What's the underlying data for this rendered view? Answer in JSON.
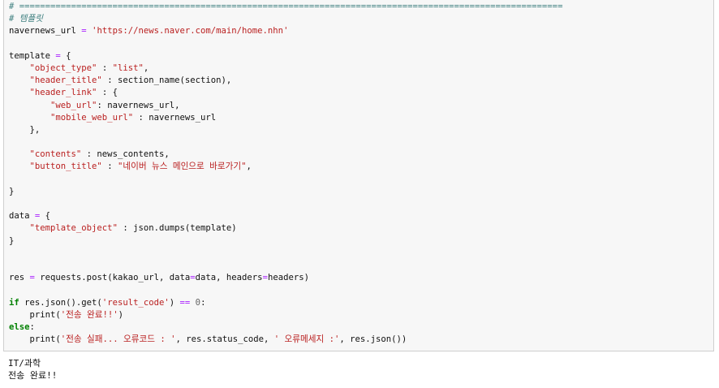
{
  "colors": {
    "cell_background": "#f7f7f7",
    "cell_border": "#cfcfcf",
    "comment": "#408080",
    "string": "#ba2121",
    "keyword": "#008000",
    "operator": "#aa22ff",
    "number": "#666666",
    "text": "#111111"
  },
  "code": [
    [
      {
        "t": "com",
        "v": "# ========================================================================================================="
      }
    ],
    [
      {
        "t": "com",
        "v": "# 템플릿"
      }
    ],
    [
      {
        "t": "txt",
        "v": "navernews_url "
      },
      {
        "t": "op",
        "v": "="
      },
      {
        "t": "txt",
        "v": " "
      },
      {
        "t": "str",
        "v": "'https://news.naver.com/main/home.nhn'"
      }
    ],
    [],
    [
      {
        "t": "txt",
        "v": "template "
      },
      {
        "t": "op",
        "v": "="
      },
      {
        "t": "txt",
        "v": " {"
      }
    ],
    [
      {
        "t": "txt",
        "v": "    "
      },
      {
        "t": "str",
        "v": "\"object_type\""
      },
      {
        "t": "txt",
        "v": " : "
      },
      {
        "t": "str",
        "v": "\"list\""
      },
      {
        "t": "txt",
        "v": ","
      }
    ],
    [
      {
        "t": "txt",
        "v": "    "
      },
      {
        "t": "str",
        "v": "\"header_title\""
      },
      {
        "t": "txt",
        "v": " : section_name(section),"
      }
    ],
    [
      {
        "t": "txt",
        "v": "    "
      },
      {
        "t": "str",
        "v": "\"header_link\""
      },
      {
        "t": "txt",
        "v": " : {"
      }
    ],
    [
      {
        "t": "txt",
        "v": "        "
      },
      {
        "t": "str",
        "v": "\"web_url\""
      },
      {
        "t": "txt",
        "v": ": navernews_url,"
      }
    ],
    [
      {
        "t": "txt",
        "v": "        "
      },
      {
        "t": "str",
        "v": "\"mobile_web_url\""
      },
      {
        "t": "txt",
        "v": " : navernews_url"
      }
    ],
    [
      {
        "t": "txt",
        "v": "    },"
      }
    ],
    [],
    [
      {
        "t": "txt",
        "v": "    "
      },
      {
        "t": "str",
        "v": "\"contents\""
      },
      {
        "t": "txt",
        "v": " : news_contents,"
      }
    ],
    [
      {
        "t": "txt",
        "v": "    "
      },
      {
        "t": "str",
        "v": "\"button_title\""
      },
      {
        "t": "txt",
        "v": " : "
      },
      {
        "t": "str",
        "v": "\"네이버 뉴스 메인으로 바로가기\""
      },
      {
        "t": "txt",
        "v": ","
      }
    ],
    [],
    [
      {
        "t": "txt",
        "v": "}"
      }
    ],
    [],
    [
      {
        "t": "txt",
        "v": "data "
      },
      {
        "t": "op",
        "v": "="
      },
      {
        "t": "txt",
        "v": " {"
      }
    ],
    [
      {
        "t": "txt",
        "v": "    "
      },
      {
        "t": "str",
        "v": "\"template_object\""
      },
      {
        "t": "txt",
        "v": " : json.dumps(template)"
      }
    ],
    [
      {
        "t": "txt",
        "v": "}"
      }
    ],
    [],
    [],
    [
      {
        "t": "txt",
        "v": "res "
      },
      {
        "t": "op",
        "v": "="
      },
      {
        "t": "txt",
        "v": " requests.post(kakao_url, data"
      },
      {
        "t": "op",
        "v": "="
      },
      {
        "t": "txt",
        "v": "data, headers"
      },
      {
        "t": "op",
        "v": "="
      },
      {
        "t": "txt",
        "v": "headers)"
      }
    ],
    [],
    [
      {
        "t": "kw",
        "v": "if"
      },
      {
        "t": "txt",
        "v": " res.json().get("
      },
      {
        "t": "str",
        "v": "'result_code'"
      },
      {
        "t": "txt",
        "v": ") "
      },
      {
        "t": "op",
        "v": "=="
      },
      {
        "t": "txt",
        "v": " "
      },
      {
        "t": "num",
        "v": "0"
      },
      {
        "t": "txt",
        "v": ":"
      }
    ],
    [
      {
        "t": "txt",
        "v": "    print("
      },
      {
        "t": "str",
        "v": "'전송 완료!!'"
      },
      {
        "t": "txt",
        "v": ")"
      }
    ],
    [
      {
        "t": "kw",
        "v": "else"
      },
      {
        "t": "txt",
        "v": ":"
      }
    ],
    [
      {
        "t": "txt",
        "v": "    print("
      },
      {
        "t": "str",
        "v": "'전송 실패... 오류코드 : '"
      },
      {
        "t": "txt",
        "v": ", res.status_code, "
      },
      {
        "t": "str",
        "v": "' 오류메세지 :'"
      },
      {
        "t": "txt",
        "v": ", res.json())"
      }
    ]
  ],
  "output": {
    "lines": [
      "IT/과학",
      "전송 완료!!"
    ]
  }
}
